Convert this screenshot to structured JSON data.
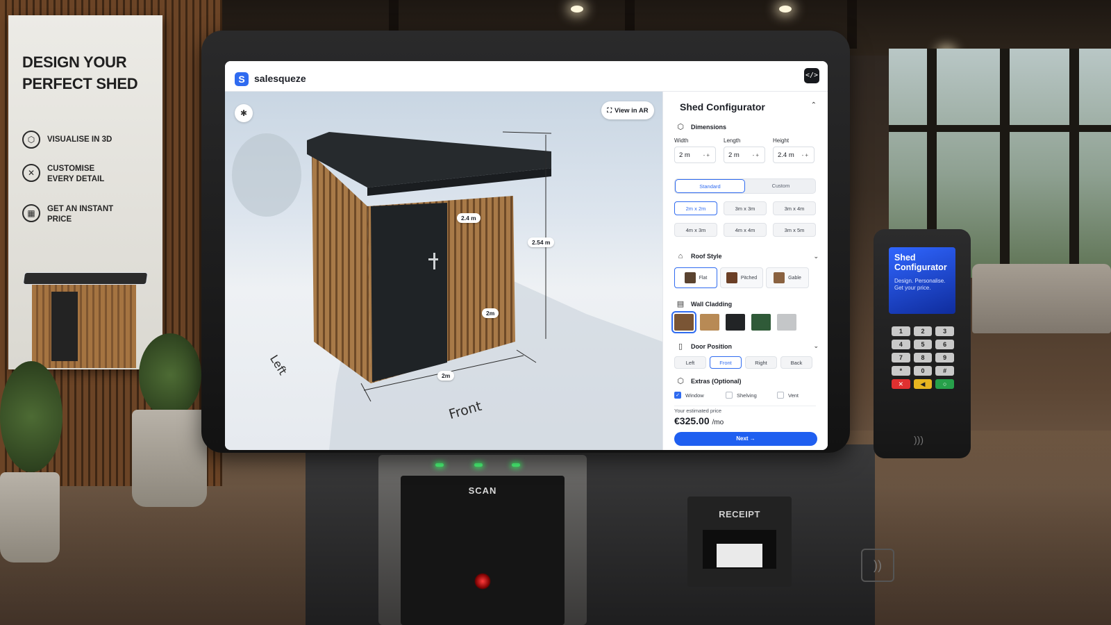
{
  "banner": {
    "heading": "DESIGN YOUR PERFECT SHED",
    "features": [
      {
        "icon": "cube-icon",
        "label": "VISUALISE IN 3D"
      },
      {
        "icon": "tools-icon",
        "label": "CUSTOMISE EVERY DETAIL"
      },
      {
        "icon": "calculator-icon",
        "label": "GET AN INSTANT PRICE"
      }
    ]
  },
  "app": {
    "brand": "salesqueze",
    "logo_letter": "S",
    "code_button": "</>"
  },
  "viewport": {
    "view_ar_label": "View in AR",
    "dimension_labels": {
      "door_height": "2.4 m",
      "total_height": "2.54 m",
      "depth": "2m",
      "width": "2m"
    },
    "ground_labels": {
      "left": "Left",
      "front": "Front"
    }
  },
  "configurator": {
    "title": "Shed Configurator",
    "dimensions": {
      "section_label": "Dimensions",
      "fields": [
        {
          "label": "Width",
          "value": "2 m"
        },
        {
          "label": "Length",
          "value": "2 m"
        },
        {
          "label": "Height",
          "value": "2.4 m"
        }
      ],
      "mode_options": [
        "Standard",
        "Custom"
      ],
      "selected_mode": "Standard",
      "sizes": [
        "2m x 2m",
        "3m x 3m",
        "3m x 4m",
        "4m x 3m",
        "4m x 4m",
        "3m x 5m"
      ],
      "selected_size": "2m x 2m"
    },
    "roof": {
      "section_label": "Roof Style",
      "options": [
        "Flat",
        "Pitched",
        "Gable"
      ],
      "selected": "Flat"
    },
    "cladding": {
      "section_label": "Wall Cladding",
      "swatches": [
        "#7a5535",
        "#b88a55",
        "#222426",
        "#2f5a38",
        "#c4c6c8"
      ],
      "selected_index": 0
    },
    "door": {
      "section_label": "Door Position",
      "options": [
        "Left",
        "Front",
        "Right",
        "Back"
      ],
      "selected": "Front"
    },
    "extras": {
      "section_label": "Extras (Optional)",
      "items": [
        {
          "label": "Window",
          "checked": true
        },
        {
          "label": "Shelving",
          "checked": false
        },
        {
          "label": "Vent",
          "checked": false
        }
      ]
    },
    "price": {
      "label": "Your estimated price",
      "amount": "€325.00",
      "period": "/mo"
    },
    "next_label": "Next →"
  },
  "scanner": {
    "label": "SCAN"
  },
  "receipt": {
    "label": "RECEIPT"
  },
  "terminal": {
    "title": "Shed Configurator",
    "subtitle": "Design. Personalise. Get your price.",
    "keys": [
      "1",
      "2",
      "3",
      "4",
      "5",
      "6",
      "7",
      "8",
      "9",
      "*",
      "0",
      "#"
    ]
  }
}
